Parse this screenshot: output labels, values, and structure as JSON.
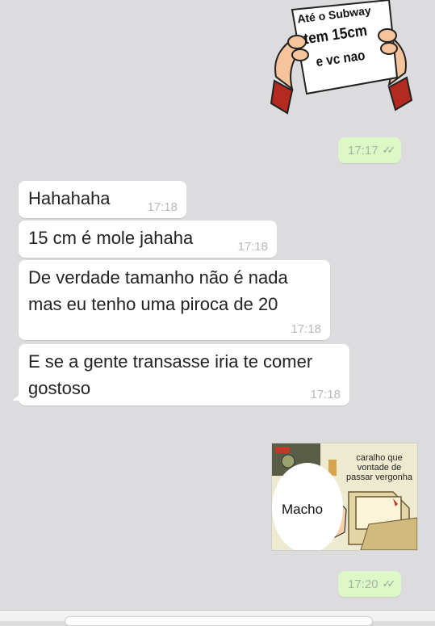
{
  "sticker": {
    "line1": "Até o Subway",
    "line2": "tem 15cm",
    "line3": "e vc nao"
  },
  "outgoing_times": [
    {
      "time": "17:17",
      "ticks": "✓✓"
    },
    {
      "time": "17:20",
      "ticks": "✓✓"
    }
  ],
  "incoming": [
    {
      "text": "Hahahaha",
      "time": "17:18"
    },
    {
      "text": "15 cm é mole jahaha",
      "time": "17:18"
    },
    {
      "text": "De verdade tamanho não é nada mas eu tenho uma piroca de 20",
      "time": "17:18"
    },
    {
      "text": "E se a gente transasse iria te comer gostoso",
      "time": "17:18"
    }
  ],
  "meme": {
    "top_text": "caralho que vontade de passar vergonha",
    "bubble_text": "Macho"
  },
  "colors": {
    "background": "#dcdcde",
    "outgoing_bubble": "#dcf8c6",
    "incoming_bubble": "#ffffff"
  }
}
